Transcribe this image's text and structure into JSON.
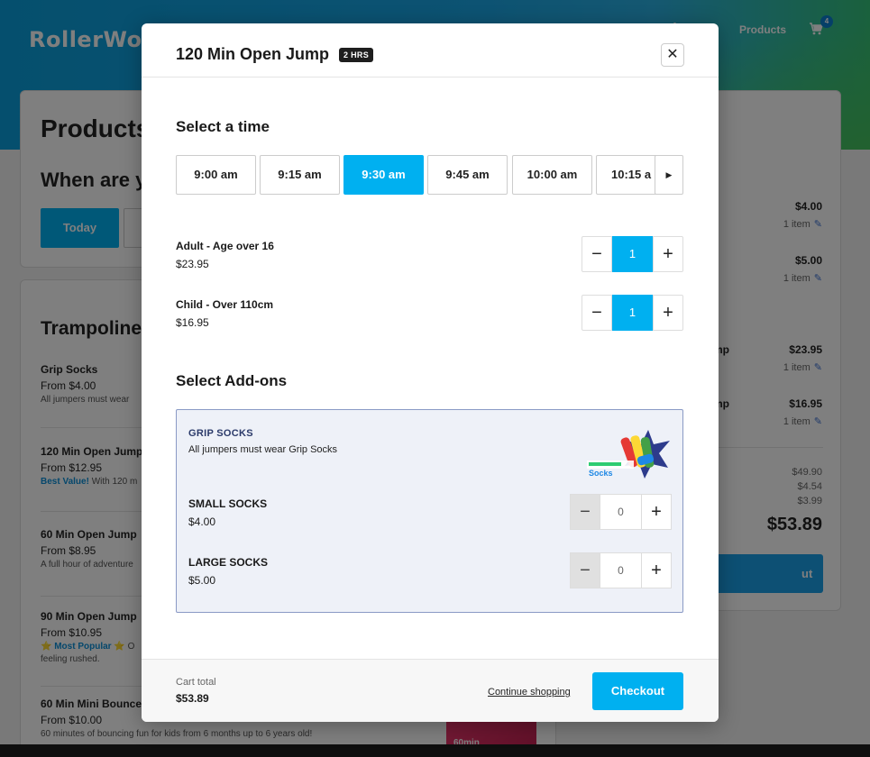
{
  "background": {
    "logo": "RollerWor",
    "nav": {
      "products": "Products",
      "cart_count": "4"
    },
    "products_title": "Products",
    "when_title": "When are y",
    "today_label": "Today",
    "section_title": "Trampoline",
    "items": [
      {
        "name": "Grip Socks",
        "price": "From $4.00",
        "desc": "All jumpers must wear"
      },
      {
        "name": "120 Min Open Jump",
        "price": "From $12.95",
        "desc_highlight": "Best Value!",
        "desc": " With 120 m"
      },
      {
        "name": "60 Min Open Jump",
        "price": "From $8.95",
        "desc": "A full hour of adventure"
      },
      {
        "name": "90 Min Open Jump",
        "price": "From $10.95",
        "desc_popular": "⭐ Most Popular ⭐",
        "desc": " O",
        "desc2": "feeling rushed."
      },
      {
        "name": "60 Min Mini Bounce",
        "price": "From $10.00",
        "desc": "60 minutes of bouncing fun for kids from 6 months up to 6 years old!"
      }
    ],
    "mini_img_label": "60min",
    "cart": {
      "lines": [
        {
          "price": "$4.00",
          "qty": "1 item"
        },
        {
          "price": "$5.00",
          "qty": "1 item"
        },
        {
          "name": "mp",
          "price": "$23.95",
          "qty": "1 item"
        },
        {
          "name": "mp",
          "price": "$16.95",
          "qty": "1 item"
        }
      ],
      "subtotal": "$49.90",
      "tax": "$4.54",
      "fee": "$3.99",
      "total": "$53.89",
      "checkout": "ut"
    }
  },
  "modal": {
    "title": "120 Min Open Jump",
    "duration_badge": "2 HRS",
    "close_icon": "close-icon",
    "select_time_title": "Select a time",
    "times": [
      "9:00 am",
      "9:15 am",
      "9:30 am",
      "9:45 am",
      "10:00 am",
      "10:15 a"
    ],
    "selected_time": "9:30 am",
    "tickets": [
      {
        "name": "Adult - Age over 16",
        "price": "$23.95",
        "qty": "1"
      },
      {
        "name": "Child - Over 110cm",
        "price": "$16.95",
        "qty": "1"
      }
    ],
    "addons_title": "Select Add-ons",
    "addon_group": {
      "category": "GRIP SOCKS",
      "description": "All jumpers must wear Grip Socks",
      "image_label": "Socks",
      "items": [
        {
          "name": "SMALL SOCKS",
          "price": "$4.00",
          "qty": "0"
        },
        {
          "name": "LARGE SOCKS",
          "price": "$5.00",
          "qty": "0"
        }
      ]
    },
    "footer": {
      "cart_label": "Cart total",
      "cart_total": "$53.89",
      "continue_label": "Continue shopping",
      "checkout_label": "Checkout"
    }
  },
  "colors": {
    "accent": "#00b0f0",
    "addon_bg": "#eef1f8",
    "addon_border": "#8a9ac5"
  }
}
